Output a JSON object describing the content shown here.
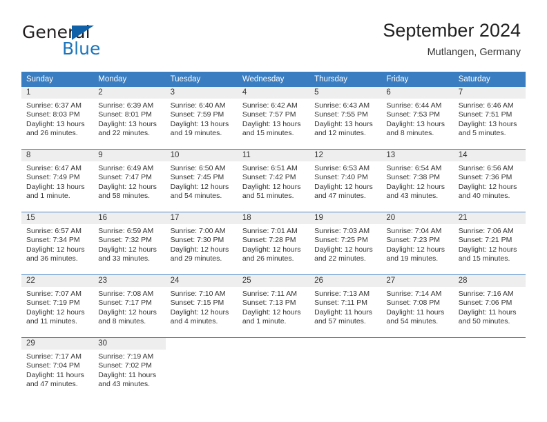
{
  "brand": {
    "name_part1": "General",
    "name_part2": "Blue",
    "logo_icon": "triangle-logo-icon",
    "colors": {
      "dark": "#231f20",
      "blue": "#1b75bb",
      "triangle": "#1060a8"
    }
  },
  "header": {
    "title": "September 2024",
    "subtitle": "Mutlangen, Germany"
  },
  "theme": {
    "header_bg": "#3a7dc0",
    "daynum_bg": "#eeeeee",
    "row_divider": "#4a86c5",
    "text": "#333333"
  },
  "weekday_headers": [
    "Sunday",
    "Monday",
    "Tuesday",
    "Wednesday",
    "Thursday",
    "Friday",
    "Saturday"
  ],
  "weeks": [
    {
      "days": [
        {
          "day": "1",
          "sunrise": "Sunrise: 6:37 AM",
          "sunset": "Sunset: 8:03 PM",
          "daylight_line1": "Daylight: 13 hours",
          "daylight_line2": "and 26 minutes."
        },
        {
          "day": "2",
          "sunrise": "Sunrise: 6:39 AM",
          "sunset": "Sunset: 8:01 PM",
          "daylight_line1": "Daylight: 13 hours",
          "daylight_line2": "and 22 minutes."
        },
        {
          "day": "3",
          "sunrise": "Sunrise: 6:40 AM",
          "sunset": "Sunset: 7:59 PM",
          "daylight_line1": "Daylight: 13 hours",
          "daylight_line2": "and 19 minutes."
        },
        {
          "day": "4",
          "sunrise": "Sunrise: 6:42 AM",
          "sunset": "Sunset: 7:57 PM",
          "daylight_line1": "Daylight: 13 hours",
          "daylight_line2": "and 15 minutes."
        },
        {
          "day": "5",
          "sunrise": "Sunrise: 6:43 AM",
          "sunset": "Sunset: 7:55 PM",
          "daylight_line1": "Daylight: 13 hours",
          "daylight_line2": "and 12 minutes."
        },
        {
          "day": "6",
          "sunrise": "Sunrise: 6:44 AM",
          "sunset": "Sunset: 7:53 PM",
          "daylight_line1": "Daylight: 13 hours",
          "daylight_line2": "and 8 minutes."
        },
        {
          "day": "7",
          "sunrise": "Sunrise: 6:46 AM",
          "sunset": "Sunset: 7:51 PM",
          "daylight_line1": "Daylight: 13 hours",
          "daylight_line2": "and 5 minutes."
        }
      ]
    },
    {
      "days": [
        {
          "day": "8",
          "sunrise": "Sunrise: 6:47 AM",
          "sunset": "Sunset: 7:49 PM",
          "daylight_line1": "Daylight: 13 hours",
          "daylight_line2": "and 1 minute."
        },
        {
          "day": "9",
          "sunrise": "Sunrise: 6:49 AM",
          "sunset": "Sunset: 7:47 PM",
          "daylight_line1": "Daylight: 12 hours",
          "daylight_line2": "and 58 minutes."
        },
        {
          "day": "10",
          "sunrise": "Sunrise: 6:50 AM",
          "sunset": "Sunset: 7:45 PM",
          "daylight_line1": "Daylight: 12 hours",
          "daylight_line2": "and 54 minutes."
        },
        {
          "day": "11",
          "sunrise": "Sunrise: 6:51 AM",
          "sunset": "Sunset: 7:42 PM",
          "daylight_line1": "Daylight: 12 hours",
          "daylight_line2": "and 51 minutes."
        },
        {
          "day": "12",
          "sunrise": "Sunrise: 6:53 AM",
          "sunset": "Sunset: 7:40 PM",
          "daylight_line1": "Daylight: 12 hours",
          "daylight_line2": "and 47 minutes."
        },
        {
          "day": "13",
          "sunrise": "Sunrise: 6:54 AM",
          "sunset": "Sunset: 7:38 PM",
          "daylight_line1": "Daylight: 12 hours",
          "daylight_line2": "and 43 minutes."
        },
        {
          "day": "14",
          "sunrise": "Sunrise: 6:56 AM",
          "sunset": "Sunset: 7:36 PM",
          "daylight_line1": "Daylight: 12 hours",
          "daylight_line2": "and 40 minutes."
        }
      ]
    },
    {
      "days": [
        {
          "day": "15",
          "sunrise": "Sunrise: 6:57 AM",
          "sunset": "Sunset: 7:34 PM",
          "daylight_line1": "Daylight: 12 hours",
          "daylight_line2": "and 36 minutes."
        },
        {
          "day": "16",
          "sunrise": "Sunrise: 6:59 AM",
          "sunset": "Sunset: 7:32 PM",
          "daylight_line1": "Daylight: 12 hours",
          "daylight_line2": "and 33 minutes."
        },
        {
          "day": "17",
          "sunrise": "Sunrise: 7:00 AM",
          "sunset": "Sunset: 7:30 PM",
          "daylight_line1": "Daylight: 12 hours",
          "daylight_line2": "and 29 minutes."
        },
        {
          "day": "18",
          "sunrise": "Sunrise: 7:01 AM",
          "sunset": "Sunset: 7:28 PM",
          "daylight_line1": "Daylight: 12 hours",
          "daylight_line2": "and 26 minutes."
        },
        {
          "day": "19",
          "sunrise": "Sunrise: 7:03 AM",
          "sunset": "Sunset: 7:25 PM",
          "daylight_line1": "Daylight: 12 hours",
          "daylight_line2": "and 22 minutes."
        },
        {
          "day": "20",
          "sunrise": "Sunrise: 7:04 AM",
          "sunset": "Sunset: 7:23 PM",
          "daylight_line1": "Daylight: 12 hours",
          "daylight_line2": "and 19 minutes."
        },
        {
          "day": "21",
          "sunrise": "Sunrise: 7:06 AM",
          "sunset": "Sunset: 7:21 PM",
          "daylight_line1": "Daylight: 12 hours",
          "daylight_line2": "and 15 minutes."
        }
      ]
    },
    {
      "days": [
        {
          "day": "22",
          "sunrise": "Sunrise: 7:07 AM",
          "sunset": "Sunset: 7:19 PM",
          "daylight_line1": "Daylight: 12 hours",
          "daylight_line2": "and 11 minutes."
        },
        {
          "day": "23",
          "sunrise": "Sunrise: 7:08 AM",
          "sunset": "Sunset: 7:17 PM",
          "daylight_line1": "Daylight: 12 hours",
          "daylight_line2": "and 8 minutes."
        },
        {
          "day": "24",
          "sunrise": "Sunrise: 7:10 AM",
          "sunset": "Sunset: 7:15 PM",
          "daylight_line1": "Daylight: 12 hours",
          "daylight_line2": "and 4 minutes."
        },
        {
          "day": "25",
          "sunrise": "Sunrise: 7:11 AM",
          "sunset": "Sunset: 7:13 PM",
          "daylight_line1": "Daylight: 12 hours",
          "daylight_line2": "and 1 minute."
        },
        {
          "day": "26",
          "sunrise": "Sunrise: 7:13 AM",
          "sunset": "Sunset: 7:11 PM",
          "daylight_line1": "Daylight: 11 hours",
          "daylight_line2": "and 57 minutes."
        },
        {
          "day": "27",
          "sunrise": "Sunrise: 7:14 AM",
          "sunset": "Sunset: 7:08 PM",
          "daylight_line1": "Daylight: 11 hours",
          "daylight_line2": "and 54 minutes."
        },
        {
          "day": "28",
          "sunrise": "Sunrise: 7:16 AM",
          "sunset": "Sunset: 7:06 PM",
          "daylight_line1": "Daylight: 11 hours",
          "daylight_line2": "and 50 minutes."
        }
      ]
    },
    {
      "days": [
        {
          "day": "29",
          "sunrise": "Sunrise: 7:17 AM",
          "sunset": "Sunset: 7:04 PM",
          "daylight_line1": "Daylight: 11 hours",
          "daylight_line2": "and 47 minutes."
        },
        {
          "day": "30",
          "sunrise": "Sunrise: 7:19 AM",
          "sunset": "Sunset: 7:02 PM",
          "daylight_line1": "Daylight: 11 hours",
          "daylight_line2": "and 43 minutes."
        },
        {
          "day": "",
          "sunrise": "",
          "sunset": "",
          "daylight_line1": "",
          "daylight_line2": ""
        },
        {
          "day": "",
          "sunrise": "",
          "sunset": "",
          "daylight_line1": "",
          "daylight_line2": ""
        },
        {
          "day": "",
          "sunrise": "",
          "sunset": "",
          "daylight_line1": "",
          "daylight_line2": ""
        },
        {
          "day": "",
          "sunrise": "",
          "sunset": "",
          "daylight_line1": "",
          "daylight_line2": ""
        },
        {
          "day": "",
          "sunrise": "",
          "sunset": "",
          "daylight_line1": "",
          "daylight_line2": ""
        }
      ]
    }
  ]
}
